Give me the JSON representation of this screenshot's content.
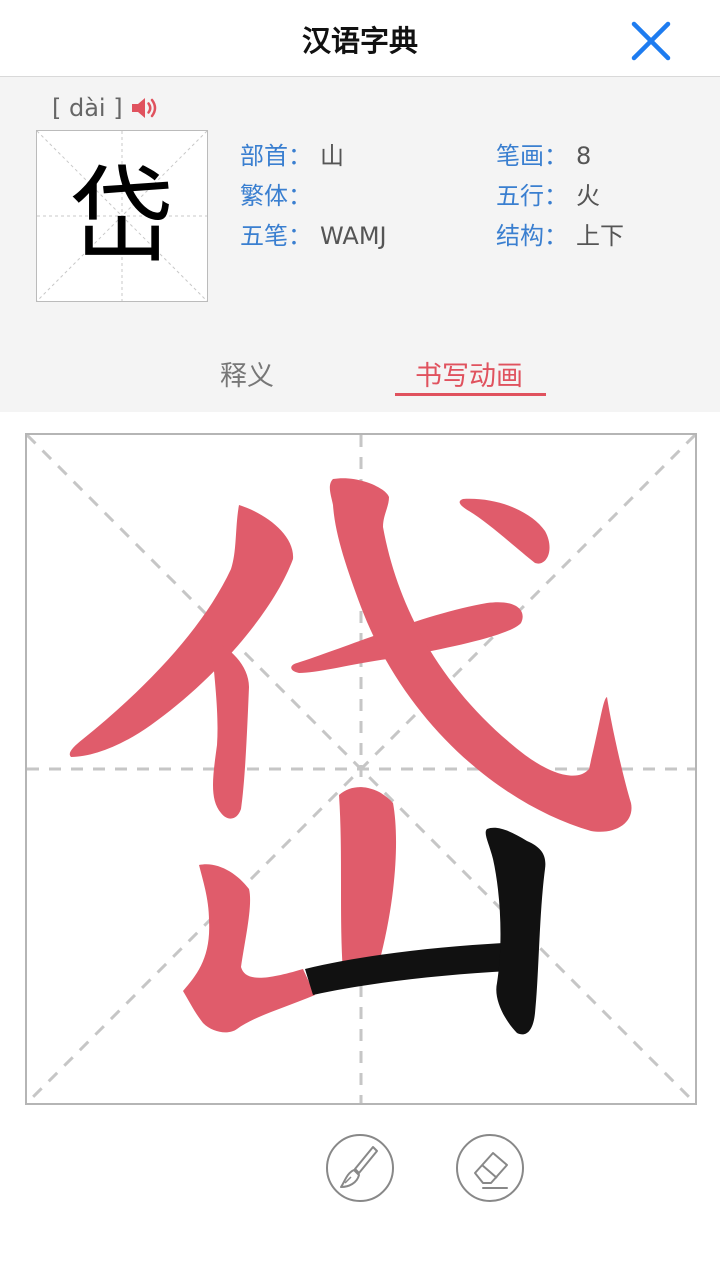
{
  "header": {
    "title": "汉语字典"
  },
  "entry": {
    "pinyin": "[ dài ]",
    "character": "岱",
    "attributes": [
      {
        "key": "部首：",
        "value": "山"
      },
      {
        "key": "笔画：",
        "value": "8"
      },
      {
        "key": "繁体：",
        "value": ""
      },
      {
        "key": "五行：",
        "value": "火"
      },
      {
        "key": "五笔：",
        "value": "WAMJ"
      },
      {
        "key": "结构：",
        "value": "上下"
      }
    ]
  },
  "tabs": [
    {
      "label": "释义",
      "active": false
    },
    {
      "label": "书写动画",
      "active": true
    }
  ],
  "colors": {
    "accent": "#e0525e",
    "link_blue": "#3a7fd0",
    "close_blue": "#1e7cf0",
    "stroke_done": "#e05c6b",
    "stroke_current": "#111111"
  },
  "animation": {
    "strokes_total": 8,
    "strokes_shown": 8,
    "current_stroke": 8
  },
  "icons": {
    "close": "close-icon",
    "speaker": "speaker-icon",
    "brush": "brush-icon",
    "eraser": "eraser-icon"
  }
}
